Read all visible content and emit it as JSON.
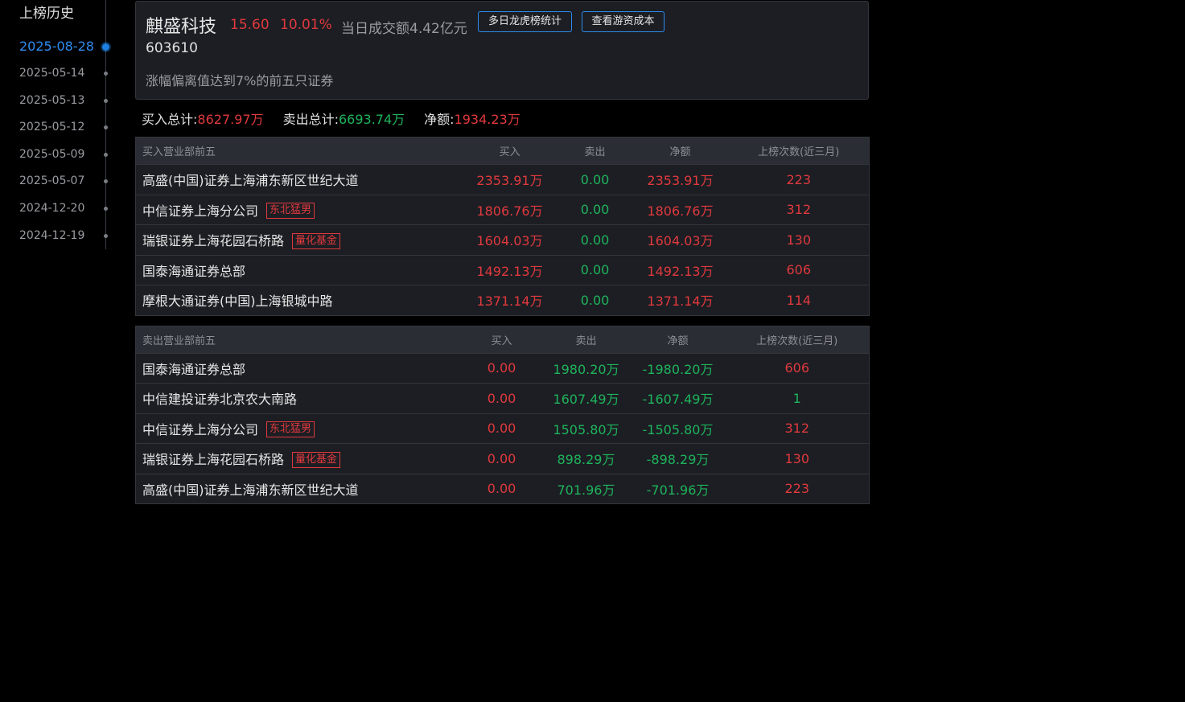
{
  "sidebar": {
    "title": "上榜历史",
    "dates": [
      {
        "label": "2025-08-28",
        "active": true
      },
      {
        "label": "2025-05-14",
        "active": false
      },
      {
        "label": "2025-05-13",
        "active": false
      },
      {
        "label": "2025-05-12",
        "active": false
      },
      {
        "label": "2025-05-09",
        "active": false
      },
      {
        "label": "2025-05-07",
        "active": false
      },
      {
        "label": "2024-12-20",
        "active": false
      },
      {
        "label": "2024-12-19",
        "active": false
      }
    ]
  },
  "stock": {
    "name": "麒盛科技",
    "price": "15.60",
    "change_pct": "10.01%",
    "turnover": "当日成交额4.42亿元",
    "code": "603610",
    "reason": "涨幅偏离值达到7%的前五只证券",
    "btn_multi_day": "多日龙虎榜统计",
    "btn_cost": "查看游资成本"
  },
  "totals": {
    "buy_label": "买入总计:",
    "buy_value": "8627.97万",
    "sell_label": "卖出总计:",
    "sell_value": "6693.74万",
    "net_label": "净额:",
    "net_value": "1934.23万"
  },
  "buy_table": {
    "headers": [
      "买入营业部前五",
      "买入",
      "卖出",
      "净额",
      "上榜次数(近三月)"
    ],
    "rows": [
      {
        "name": "高盛(中国)证券上海浦东新区世纪大道",
        "tag": "",
        "buy": "2353.91万",
        "sell": "0.00",
        "net": "2353.91万",
        "count": "223"
      },
      {
        "name": "中信证券上海分公司",
        "tag": "东北猛男",
        "buy": "1806.76万",
        "sell": "0.00",
        "net": "1806.76万",
        "count": "312"
      },
      {
        "name": "瑞银证券上海花园石桥路",
        "tag": "量化基金",
        "buy": "1604.03万",
        "sell": "0.00",
        "net": "1604.03万",
        "count": "130"
      },
      {
        "name": "国泰海通证券总部",
        "tag": "",
        "buy": "1492.13万",
        "sell": "0.00",
        "net": "1492.13万",
        "count": "606"
      },
      {
        "name": "摩根大通证券(中国)上海银城中路",
        "tag": "",
        "buy": "1371.14万",
        "sell": "0.00",
        "net": "1371.14万",
        "count": "114"
      }
    ]
  },
  "sell_table": {
    "headers": [
      "卖出营业部前五",
      "买入",
      "卖出",
      "净额",
      "上榜次数(近三月)"
    ],
    "rows": [
      {
        "name": "国泰海通证券总部",
        "tag": "",
        "buy": "0.00",
        "sell": "1980.20万",
        "net": "-1980.20万",
        "count": "606"
      },
      {
        "name": "中信建投证券北京农大南路",
        "tag": "",
        "buy": "0.00",
        "sell": "1607.49万",
        "net": "-1607.49万",
        "count": "1"
      },
      {
        "name": "中信证券上海分公司",
        "tag": "东北猛男",
        "buy": "0.00",
        "sell": "1505.80万",
        "net": "-1505.80万",
        "count": "312"
      },
      {
        "name": "瑞银证券上海花园石桥路",
        "tag": "量化基金",
        "buy": "0.00",
        "sell": "898.29万",
        "net": "-898.29万",
        "count": "130"
      },
      {
        "name": "高盛(中国)证券上海浦东新区世纪大道",
        "tag": "",
        "buy": "0.00",
        "sell": "701.96万",
        "net": "-701.96万",
        "count": "223"
      }
    ]
  },
  "colors": {
    "up": "#e0393e",
    "down": "#1fb35c",
    "accent": "#2f8cf0"
  }
}
